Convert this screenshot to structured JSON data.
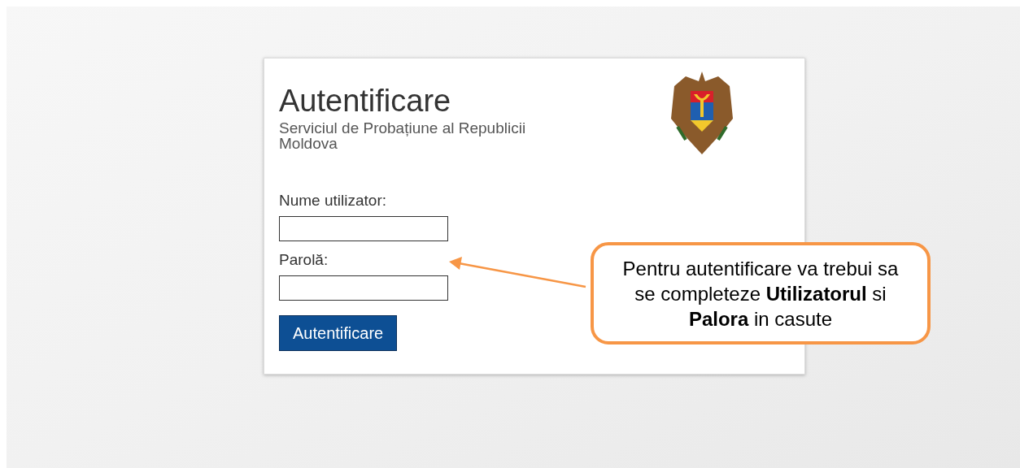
{
  "login_card": {
    "title": "Autentificare",
    "subtitle": "Serviciul de Probațiune al Republicii Moldova",
    "fields": [
      {
        "label": "Nume utilizator:"
      },
      {
        "label": "Parolă:"
      }
    ],
    "submit_button": "Autentificare"
  },
  "callout": {
    "text": "Pentru autentificare va trebui sa se completeze **Utilizatorul** si **Palora** in casute"
  }
}
